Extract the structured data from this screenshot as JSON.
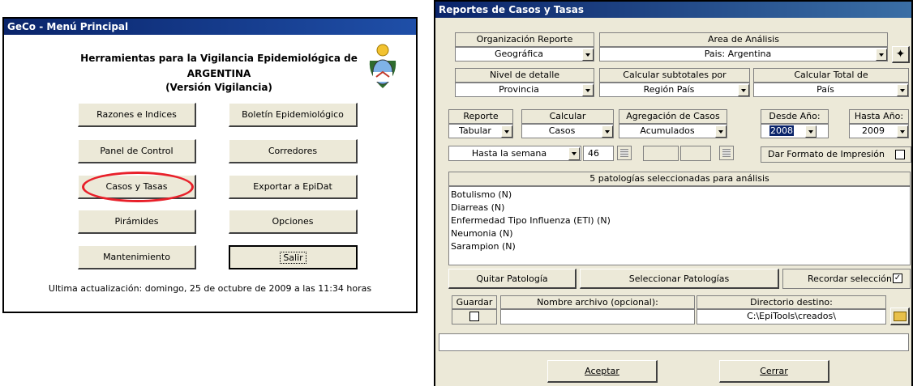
{
  "menu": {
    "title": "GeCo - Menú Principal",
    "heading1": "Herramientas para la Vigilancia Epidemiológica de",
    "heading2": "ARGENTINA",
    "heading3": "(Versión Vigilancia)",
    "buttons": {
      "razones": "Razones e Indices",
      "boletin": "Boletín Epidemiológico",
      "panel": "Panel de Control",
      "corredores": "Corredores",
      "casos": "Casos y Tasas",
      "exportar": "Exportar a EpiDat",
      "piramides": "Pirámides",
      "opciones": "Opciones",
      "mantenimiento": "Mantenimiento",
      "salir": "Salir"
    },
    "footer": "Ultima actualización: domingo, 25 de octubre de 2009 a las 11:34 horas"
  },
  "reports": {
    "title": "Reportes de Casos y Tasas",
    "org_label": "Organización Reporte",
    "org_value": "Geográfica",
    "area_label": "Area de Análisis",
    "area_value": "Pais: Argentina",
    "nivel_label": "Nivel de detalle",
    "nivel_value": "Provincia",
    "subtot_label": "Calcular subtotales por",
    "subtot_value": "Región País",
    "total_label": "Calcular Total de",
    "total_value": "País",
    "reporte_label": "Reporte",
    "reporte_value": "Tabular",
    "calcular_label": "Calcular",
    "calcular_value": "Casos",
    "agregacion_label": "Agregación de Casos",
    "agregacion_value": "Acumulados",
    "desde_label": "Desde Año:",
    "desde_value": "2008",
    "hasta_label": "Hasta Año:",
    "hasta_value": "2009",
    "semana_value": "Hasta la semana",
    "semana_num": "46",
    "formato_label": "Dar Formato de Impresión",
    "pat_header": "5 patologías seleccionadas para análisis",
    "patologias": [
      "Botulismo (N)",
      "Diarreas  (N)",
      "Enfermedad Tipo Influenza (ETI) (N)",
      "Neumonia (N)",
      "Sarampion (N)"
    ],
    "quitar": "Quitar Patología",
    "seleccionar": "Seleccionar Patologías",
    "recordar": "Recordar selección",
    "guardar_label": "Guardar",
    "nombre_label": "Nombre archivo (opcional):",
    "dir_label": "Directorio destino:",
    "dir_value": "C:\\EpiTools\\creados\\",
    "aceptar": "Aceptar",
    "cerrar": "Cerrar"
  },
  "colors": {
    "titlebar": "#0a246a",
    "dialog_bg": "#ece9d8",
    "highlight": "#e8202a"
  }
}
